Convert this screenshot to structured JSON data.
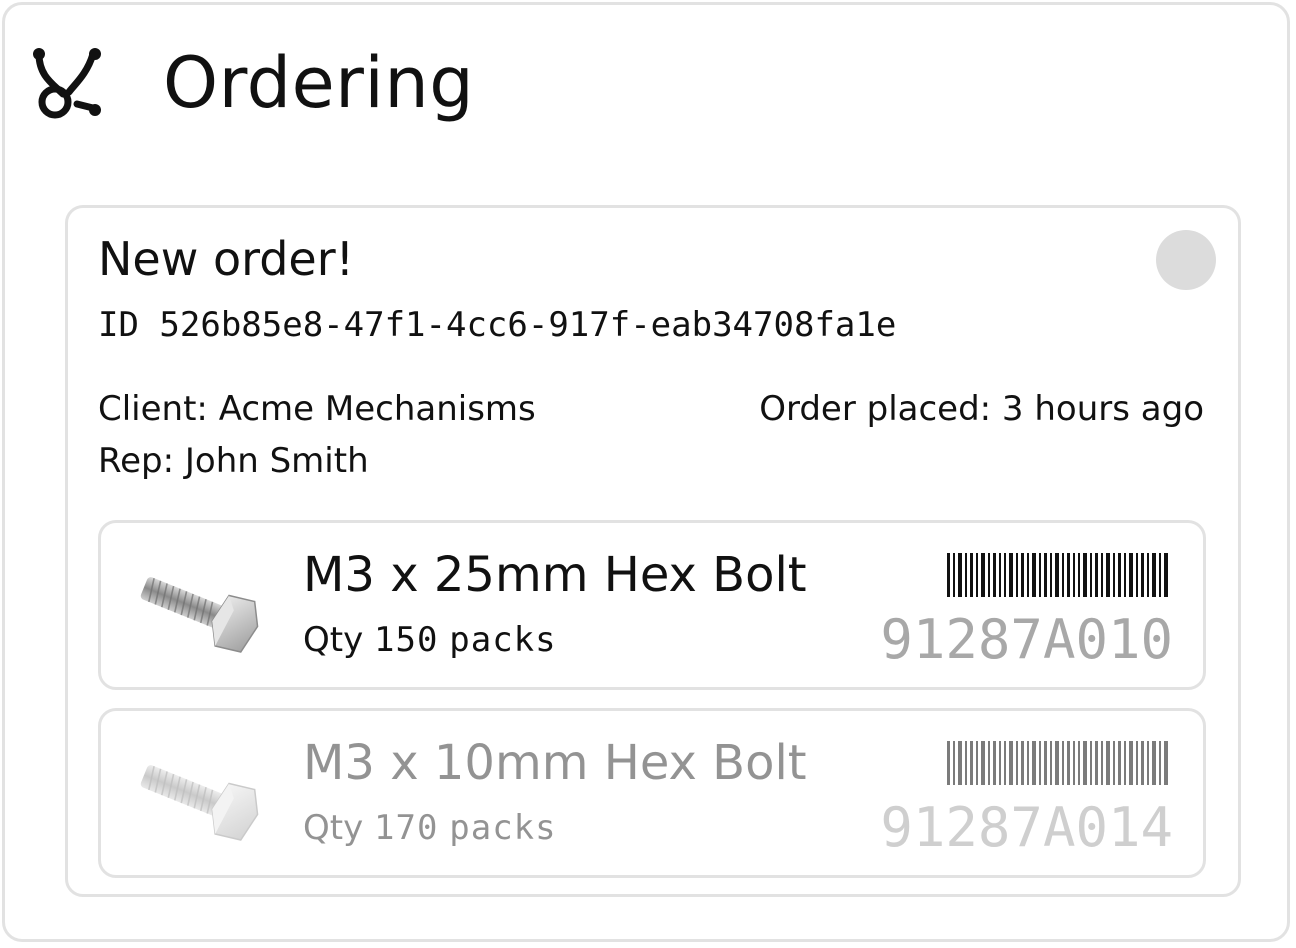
{
  "app": {
    "title": "Ordering",
    "icon": "nodes-branch-icon"
  },
  "order": {
    "heading": "New order!",
    "id_text": "ID 526b85e8-47f1-4cc6-917f-eab34708fa1e",
    "status_color": "#dcdcdc",
    "client_text": "Client: Acme Mechanisms",
    "rep_text": "Rep: John Smith",
    "placed_text": "Order placed: 3 hours ago",
    "items": [
      {
        "name": "M3 x 25mm Hex Bolt",
        "qty_prefix": "Qty",
        "qty_value": "150",
        "qty_unit": "packs",
        "part_number": "91287A010",
        "icon": "hex-bolt-icon",
        "dimmed": false
      },
      {
        "name": "M3 x 10mm Hex Bolt",
        "qty_prefix": "Qty",
        "qty_value": "170",
        "qty_unit": "packs",
        "part_number": "91287A014",
        "icon": "hex-bolt-icon",
        "dimmed": true
      }
    ]
  }
}
